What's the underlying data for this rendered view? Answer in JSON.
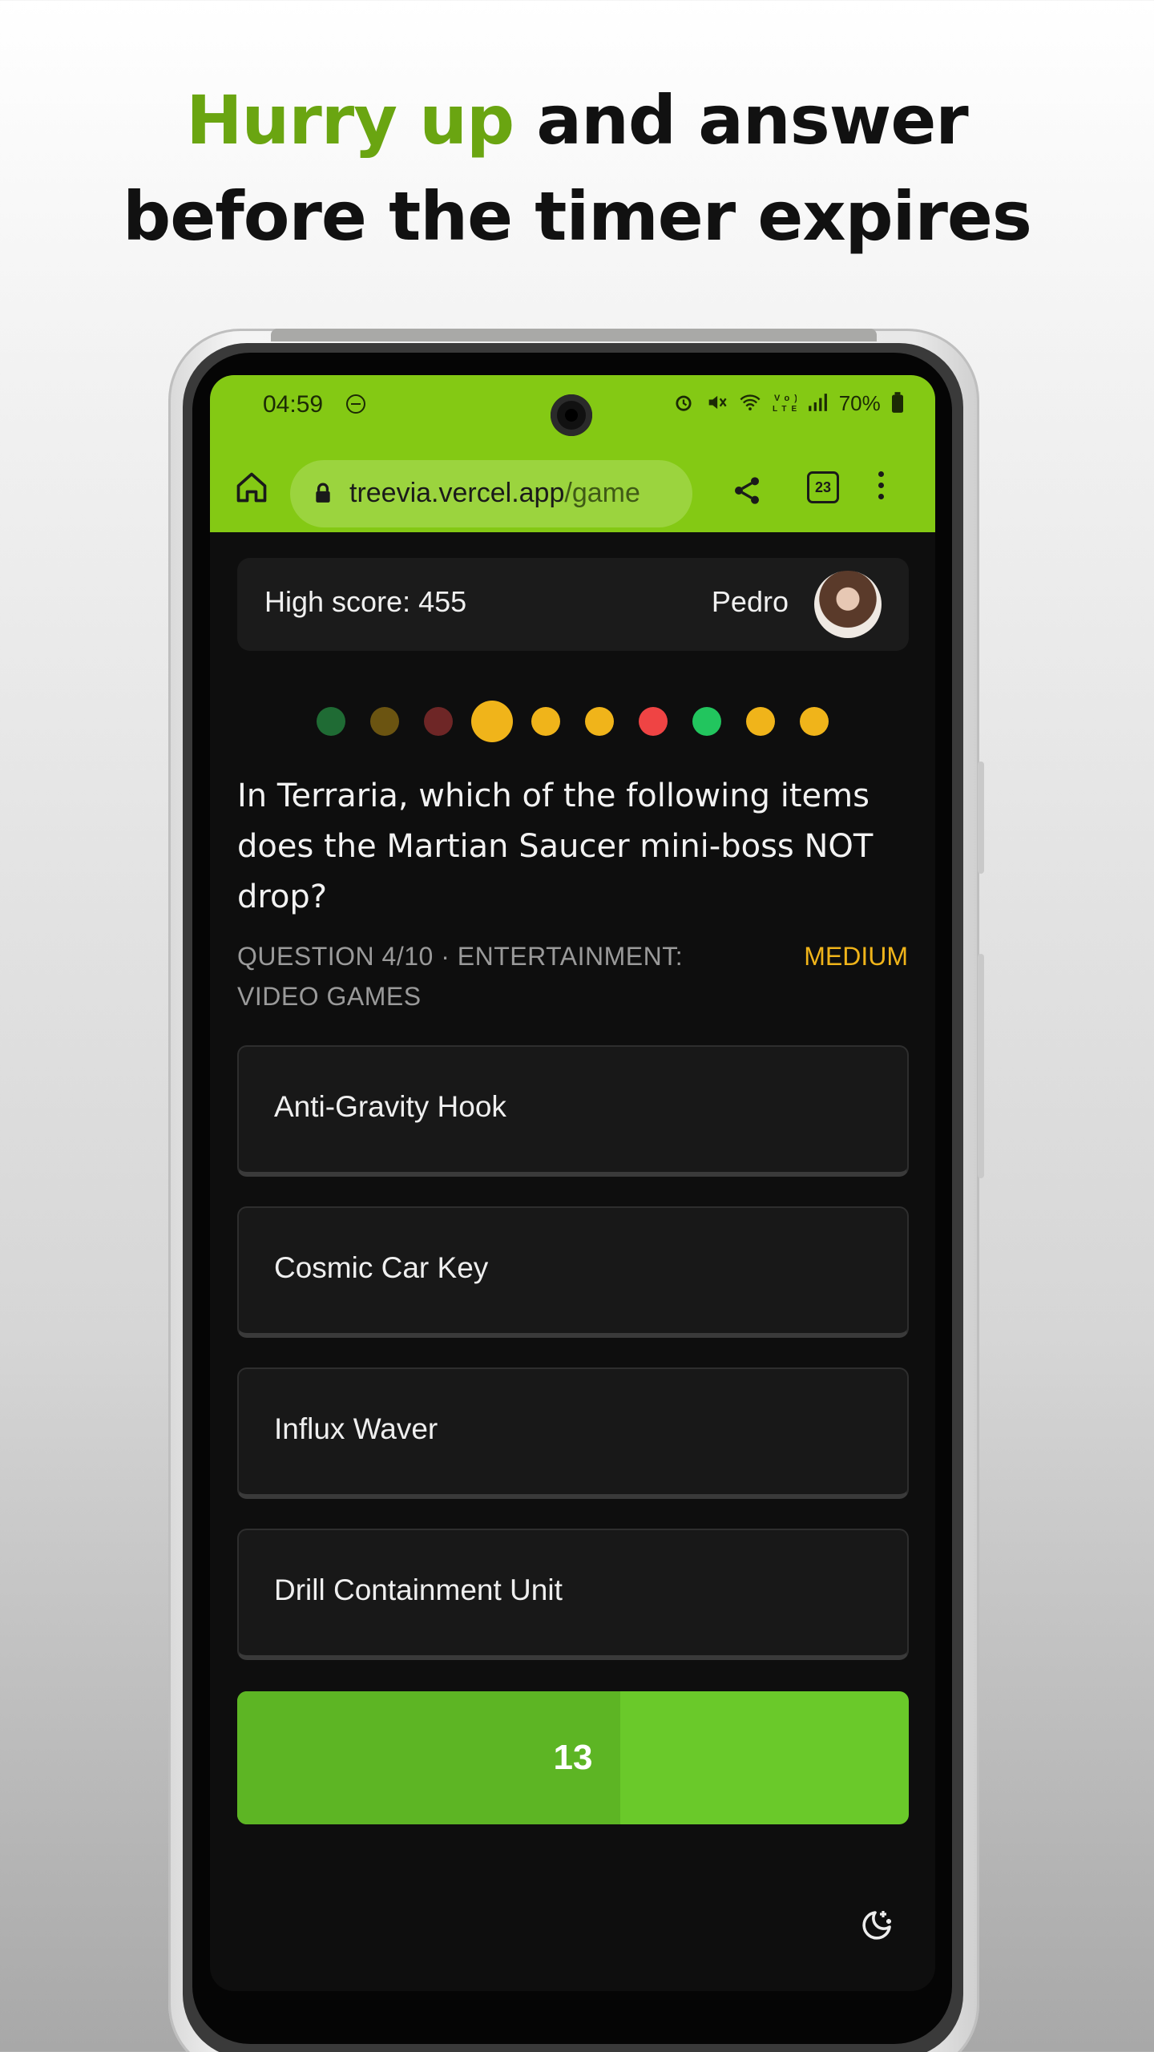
{
  "headline": {
    "accent": "Hurry up",
    "rest_line1": " and answer",
    "line2": "before the timer expires"
  },
  "status_bar": {
    "time": "04:59",
    "battery": "70%",
    "icons": [
      "alarm-icon",
      "mute-icon",
      "wifi-icon",
      "volte-icon",
      "signal-icon",
      "battery-icon"
    ]
  },
  "browser": {
    "url_host": "treevia.vercel.app",
    "url_path": "/game",
    "tab_count": "23"
  },
  "header": {
    "high_score": "High score: 455",
    "player_name": "Pedro"
  },
  "progress": {
    "dots": [
      {
        "color": "#1f6b34",
        "state": "past-correct"
      },
      {
        "color": "#6b5411",
        "state": "past-correct"
      },
      {
        "color": "#6e2626",
        "state": "past-wrong"
      },
      {
        "color": "#f0b41a",
        "state": "current"
      },
      {
        "color": "#f0b41a",
        "state": "upcoming"
      },
      {
        "color": "#f0b41a",
        "state": "upcoming"
      },
      {
        "color": "#ef4444",
        "state": "upcoming"
      },
      {
        "color": "#22c55e",
        "state": "upcoming"
      },
      {
        "color": "#f0b41a",
        "state": "upcoming"
      },
      {
        "color": "#f0b41a",
        "state": "upcoming"
      }
    ]
  },
  "question": {
    "text": "In Terraria, which of the following items does the Martian Saucer mini-boss NOT drop?",
    "meta": "QUESTION 4/10 · ENTERTAINMENT: VIDEO GAMES",
    "difficulty": "MEDIUM"
  },
  "answers": [
    {
      "label": "Anti-Gravity Hook"
    },
    {
      "label": "Cosmic Car Key"
    },
    {
      "label": "Influx Waver"
    },
    {
      "label": "Drill Containment Unit"
    }
  ],
  "timer": {
    "seconds_left": "13",
    "elapsed_fraction": 0.57
  },
  "colors": {
    "accent_green": "#84c914",
    "medium": "#f0b41a"
  }
}
